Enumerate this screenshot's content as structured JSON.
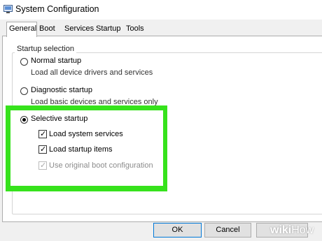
{
  "window": {
    "title": "System Configuration"
  },
  "tabs": [
    {
      "label": "General",
      "active": true
    },
    {
      "label": "Boot"
    },
    {
      "label": "Services"
    },
    {
      "label": "Startup"
    },
    {
      "label": "Tools"
    }
  ],
  "startup": {
    "group_label": "Startup selection",
    "normal": {
      "label": "Normal startup",
      "desc": "Load all device drivers and services",
      "selected": false
    },
    "diagnostic": {
      "label": "Diagnostic startup",
      "desc": "Load basic devices and services only",
      "selected": false
    },
    "selective": {
      "label": "Selective startup",
      "selected": true,
      "options": [
        {
          "label": "Load system services",
          "checked": true,
          "enabled": true
        },
        {
          "label": "Load startup items",
          "checked": true,
          "enabled": true
        },
        {
          "label": "Use original boot configuration",
          "checked": true,
          "enabled": false
        }
      ]
    }
  },
  "buttons": {
    "ok": "OK",
    "cancel": "Cancel"
  },
  "highlight_color": "#36e21c",
  "watermark": {
    "bold": "wiki",
    "light": "How"
  }
}
